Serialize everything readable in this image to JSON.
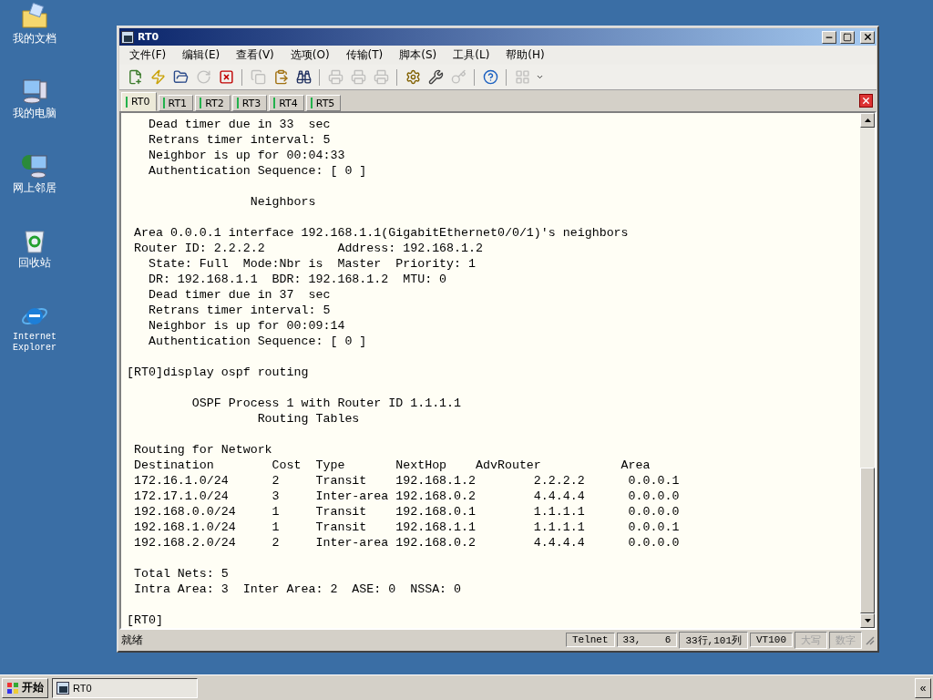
{
  "desktop_icons": [
    {
      "kind": "documents",
      "label": "我的文档"
    },
    {
      "kind": "computer",
      "label": "我的电脑"
    },
    {
      "kind": "network",
      "label": "网上邻居"
    },
    {
      "kind": "recycle",
      "label": "回收站"
    },
    {
      "kind": "browser",
      "label": "Internet Explorer"
    }
  ],
  "window": {
    "title": "RT0"
  },
  "menu": [
    "文件(F)",
    "编辑(E)",
    "查看(V)",
    "选项(O)",
    "传输(T)",
    "脚本(S)",
    "工具(L)",
    "帮助(H)"
  ],
  "toolbar": [
    {
      "kind": "new",
      "disabled": false
    },
    {
      "kind": "quick",
      "disabled": false
    },
    {
      "kind": "folder",
      "disabled": false
    },
    {
      "kind": "reconnect",
      "disabled": true
    },
    {
      "kind": "disconnect",
      "disabled": false
    },
    {
      "kind": "separator"
    },
    {
      "kind": "copy",
      "disabled": true
    },
    {
      "kind": "paste",
      "disabled": false
    },
    {
      "kind": "find",
      "disabled": false
    },
    {
      "kind": "separator"
    },
    {
      "kind": "print",
      "disabled": true
    },
    {
      "kind": "print",
      "disabled": true
    },
    {
      "kind": "printer",
      "disabled": true
    },
    {
      "kind": "separator"
    },
    {
      "kind": "options",
      "disabled": false
    },
    {
      "kind": "tools",
      "disabled": false
    },
    {
      "kind": "key",
      "disabled": true
    },
    {
      "kind": "separator"
    },
    {
      "kind": "help",
      "disabled": false
    },
    {
      "kind": "separator"
    },
    {
      "kind": "grid",
      "disabled": true
    }
  ],
  "tabs": [
    {
      "label": "RT0",
      "selected": true
    },
    {
      "label": "RT1",
      "selected": false
    },
    {
      "label": "RT2",
      "selected": false
    },
    {
      "label": "RT3",
      "selected": false
    },
    {
      "label": "RT4",
      "selected": false
    },
    {
      "label": "RT5",
      "selected": false
    }
  ],
  "terminal": {
    "blocks": [
      [
        "   Dead timer due in 33  sec",
        "   Retrans timer interval: 5",
        "   Neighbor is up for 00:04:33",
        "   Authentication Sequence: [ 0 ]"
      ],
      [
        "                 Neighbors"
      ],
      [
        " Area 0.0.0.1 interface 192.168.1.1(GigabitEthernet0/0/1)'s neighbors",
        " Router ID: 2.2.2.2          Address: 192.168.1.2",
        "   State: Full  Mode:Nbr is  Master  Priority: 1",
        "   DR: 192.168.1.1  BDR: 192.168.1.2  MTU: 0",
        "   Dead timer due in 37  sec",
        "   Retrans timer interval: 5",
        "   Neighbor is up for 00:09:14",
        "   Authentication Sequence: [ 0 ]"
      ],
      [
        "[RT0]display ospf routing"
      ],
      [
        "         OSPF Process 1 with Router ID 1.1.1.1",
        "                  Routing Tables"
      ],
      [
        " Routing for Network",
        " Destination        Cost  Type       NextHop    AdvRouter           Area",
        " 172.16.1.0/24      2     Transit    192.168.1.2        2.2.2.2      0.0.0.1",
        " 172.17.1.0/24      3     Inter-area 192.168.0.2        4.4.4.4      0.0.0.0",
        " 192.168.0.0/24     1     Transit    192.168.0.1        1.1.1.1      0.0.0.0",
        " 192.168.1.0/24     1     Transit    192.168.1.1        1.1.1.1      0.0.0.1",
        " 192.168.2.0/24     2     Inter-area 192.168.0.2        4.4.4.4      0.0.0.0"
      ],
      [
        " Total Nets: 5",
        " Intra Area: 3  Inter Area: 2  ASE: 0  NSSA: 0"
      ],
      [
        "[RT0]"
      ]
    ]
  },
  "status_bar": {
    "message": "就绪",
    "fields": [
      {
        "text": "Telnet",
        "disabled": false
      },
      {
        "text": "33,    6",
        "disabled": false
      },
      {
        "text": "33行,101列",
        "disabled": false
      },
      {
        "text": "VT100",
        "disabled": false
      },
      {
        "text": "大写",
        "disabled": true
      },
      {
        "text": "数字",
        "disabled": true
      }
    ]
  },
  "taskbar": {
    "start": "开始",
    "tasks": [
      {
        "label": "RT0",
        "selected": true
      }
    ],
    "tray_button": "«"
  }
}
